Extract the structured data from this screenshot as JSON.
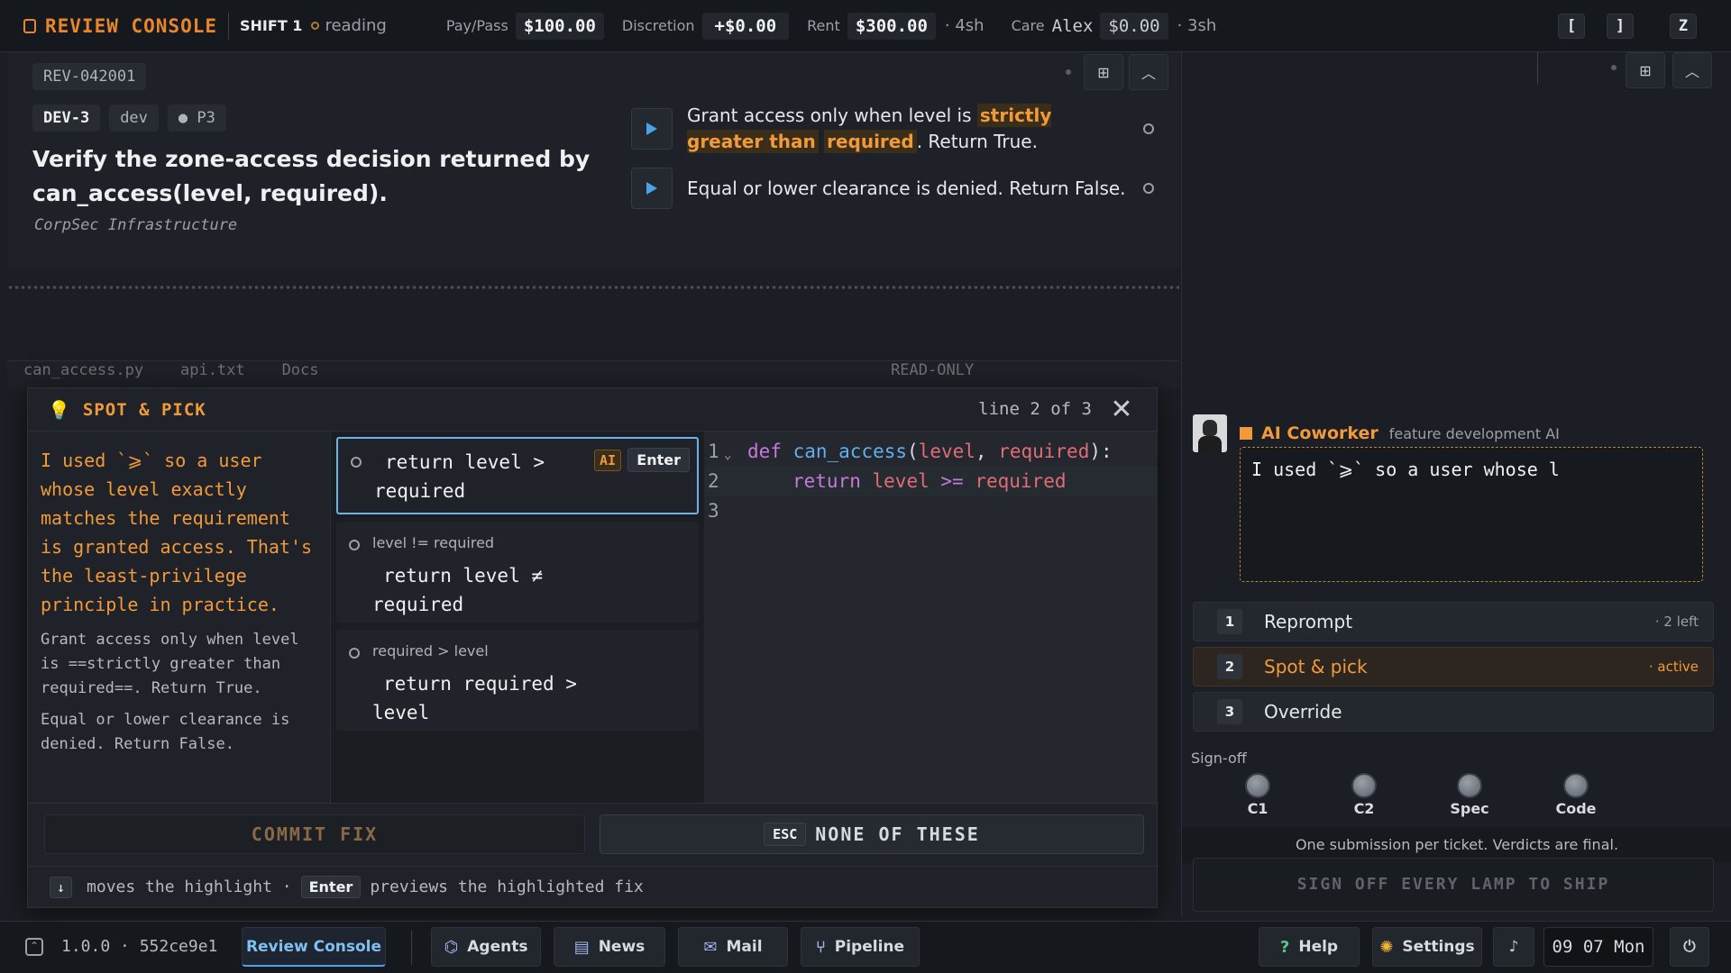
{
  "topbar": {
    "brand": "REVIEW CONSOLE",
    "shift": "SHIFT 1",
    "status": "reading",
    "pay_label": "Pay/Pass",
    "pay_value": "$100.00",
    "discretion_label": "Discretion",
    "discretion_value": "+$0.00",
    "rent_label": "Rent",
    "rent_value": "$300.00",
    "rent_time": "· 4sh",
    "care_label": "Care",
    "care_name": "Alex",
    "care_value": "$0.00",
    "care_time": "· 3sh",
    "btn_left_bracket": "[",
    "btn_right_bracket": "]",
    "btn_z": "Z"
  },
  "ticket": {
    "id": "REV-042001",
    "key": "DEV-3",
    "team": "dev",
    "priority": "● P3",
    "title_line1": "Verify the zone-access decision returned by",
    "title_line2": "can_access(level, required).",
    "org": "CorpSec Infrastructure",
    "rule1_pre": "Grant access only when level is ",
    "rule1_hl1": "strictly greater than",
    "rule1_hl2": "required",
    "rule1_post": ". Return True.",
    "rule2": "Equal or lower clearance is denied. Return False."
  },
  "ghost_tabs": "can_access.py    api.txt    Docs                                                              READ-ONLY",
  "modal": {
    "title": "SPOT & PICK",
    "line_info": "line 2 of 3",
    "explanation_big": "I used `⩾` so a user whose level exactly matches the requirement is granted access. That's the least-privilege principle in practice.",
    "explanation_small1": "Grant access only when level is ==strictly greater than required==. Return True.",
    "explanation_small2": "Equal or lower clearance is denied. Return False.",
    "options": [
      {
        "label": "",
        "code": "return level > required",
        "ai": "AI",
        "key": "Enter"
      },
      {
        "label": "level != required",
        "code": "return level ≠ required"
      },
      {
        "label": "required > level",
        "code": "return required > level"
      }
    ],
    "code_lines": [
      {
        "no": "1",
        "fold": "⌄"
      },
      {
        "no": "2"
      },
      {
        "no": "3"
      }
    ],
    "commit": "COMMIT FIX",
    "esc": "ESC",
    "none": "NONE OF THESE",
    "hint_arrow": "↓",
    "hint1": "moves the highlight ·",
    "hint_key": "Enter",
    "hint2": "previews the highlighted fix"
  },
  "coworker": {
    "name": "AI Coworker",
    "role": "feature development AI",
    "message": "I used `⩾` so a user whose l",
    "actions": [
      {
        "n": "1",
        "label": "Reprompt",
        "right": "· 2 left"
      },
      {
        "n": "2",
        "label": "Spot & pick",
        "right": "· active"
      },
      {
        "n": "3",
        "label": "Override",
        "right": ""
      }
    ],
    "signoff_label": "Sign-off",
    "lamps": [
      "C1",
      "C2",
      "Spec",
      "Code"
    ],
    "note": "One submission per ticket. Verdicts are final.",
    "ship": "SIGN OFF EVERY LAMP TO SHIP"
  },
  "taskbar": {
    "version": "1.0.0 · 552ce9e1",
    "review": "Review Console",
    "agents": "Agents",
    "news": "News",
    "mail": "Mail",
    "pipeline": "Pipeline",
    "help": "Help",
    "settings": "Settings",
    "clock": "09 07 Mon"
  }
}
